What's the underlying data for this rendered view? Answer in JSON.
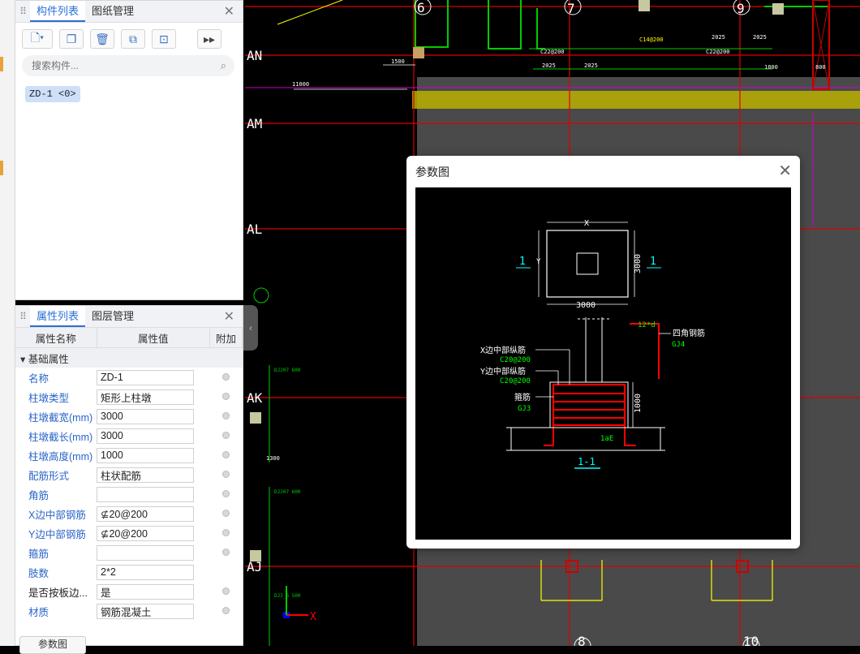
{
  "component_panel": {
    "tabs": [
      "构件列表",
      "图纸管理"
    ],
    "search_placeholder": "搜索构件...",
    "selected_item": "ZD-1 <0>"
  },
  "property_panel": {
    "tabs": [
      "属性列表",
      "图层管理"
    ],
    "headers": [
      "属性名称",
      "属性值",
      "附加"
    ],
    "group": "基础属性",
    "rows": [
      {
        "name": "名称",
        "value": "ZD-1"
      },
      {
        "name": "柱墩类型",
        "value": "矩形上柱墩"
      },
      {
        "name": "柱墩截宽(mm)",
        "value": "3000"
      },
      {
        "name": "柱墩截长(mm)",
        "value": "3000"
      },
      {
        "name": "柱墩高度(mm)",
        "value": "1000"
      },
      {
        "name": "配筋形式",
        "value": "柱状配筋"
      },
      {
        "name": "角筋",
        "value": ""
      },
      {
        "name": "X边中部钢筋",
        "value": "⊈20@200"
      },
      {
        "name": "Y边中部钢筋",
        "value": "⊈20@200"
      },
      {
        "name": "箍筋",
        "value": ""
      },
      {
        "name": "肢数",
        "value": "2*2"
      },
      {
        "name": "是否按板边...",
        "value": "是"
      },
      {
        "name": "材质",
        "value": "钢筋混凝土"
      }
    ],
    "param_button": "参数图"
  },
  "dialog": {
    "title": "参数图",
    "diagram": {
      "x_label": "X",
      "y_label": "Y",
      "dim_top": "X",
      "dim_bottom": "3000",
      "dim_right": "3000",
      "section_mark": "1",
      "x_mid_bar": "X边中部纵筋",
      "x_mid_spec": "C20@200",
      "y_mid_bar": "Y边中部纵筋",
      "y_mid_spec": "C20@200",
      "stirrup": "箍筋",
      "stirrup_code": "GJ3",
      "corner_bar": "四角钢筋",
      "corner_code": "GJ4",
      "hook": "12*d",
      "height": "1000",
      "anchor": "1aE",
      "section_title": "1-1"
    }
  },
  "cad": {
    "axis_labels": [
      "AN",
      "AM",
      "AL",
      "AK",
      "AJ"
    ],
    "grid_numbers": [
      "6",
      "7",
      "9",
      "8",
      "10"
    ],
    "dims": [
      "1500",
      "2025",
      "2025",
      "2025",
      "2025",
      "1800",
      "800",
      "11000",
      "1300"
    ],
    "notes": [
      "C22@200",
      "C14@200",
      "C22@200",
      "DJJ07 600",
      "DJJ07 600",
      "DJJ_6 500"
    ],
    "ucs": "X"
  }
}
